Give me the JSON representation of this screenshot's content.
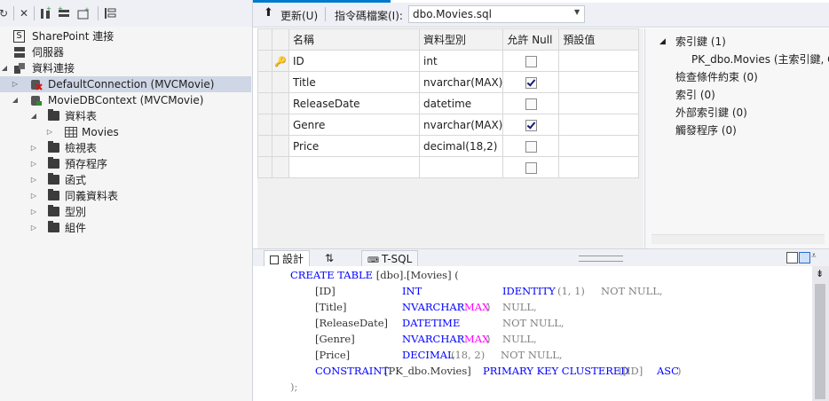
{
  "explorer": {
    "items": [
      {
        "label": "SharePoint 連接"
      },
      {
        "label": "伺服器"
      },
      {
        "label": "資料連接"
      },
      {
        "label": "DefaultConnection (MVCMovie)"
      },
      {
        "label": "MovieDBContext (MVCMovie)"
      },
      {
        "label": "資料表"
      },
      {
        "label": "Movies"
      },
      {
        "label": "檢視表"
      },
      {
        "label": "預存程序"
      },
      {
        "label": "函式"
      },
      {
        "label": "同義資料表"
      },
      {
        "label": "型別"
      },
      {
        "label": "組件"
      }
    ]
  },
  "designer_toolbar": {
    "update_label": "更新(U)",
    "script_file_label": "指令碼檔案(I):",
    "script_file_value": "dbo.Movies.sql"
  },
  "columns_grid": {
    "headers": [
      "名稱",
      "資料型別",
      "允許 Null",
      "預設值"
    ],
    "rows": [
      {
        "name": "ID",
        "type": "int",
        "allow_null": false,
        "key": true
      },
      {
        "name": "Title",
        "type": "nvarchar(MAX)",
        "allow_null": true,
        "key": false
      },
      {
        "name": "ReleaseDate",
        "type": "datetime",
        "allow_null": false,
        "key": false
      },
      {
        "name": "Genre",
        "type": "nvarchar(MAX)",
        "allow_null": true,
        "key": false
      },
      {
        "name": "Price",
        "type": "decimal(18,2)",
        "allow_null": false,
        "key": false
      },
      {
        "name": "",
        "type": "",
        "allow_null": false,
        "key": false
      }
    ]
  },
  "properties_panel": {
    "keys": "索引鍵 (1)",
    "pk": "PK_dbo.Movies (主索引鍵, C",
    "checks": "檢查條件約束 (0)",
    "indexes": "索引 (0)",
    "foreign_keys": "外部索引鍵 (0)",
    "triggers": "觸發程序 (0)"
  },
  "bottom_tabs": {
    "design": "設計",
    "swap": "⇅",
    "tsql": "T-SQL"
  },
  "sql": {
    "l1_kw": "CREATE TABLE",
    "l1_rest": " [dbo].[Movies] (",
    "c1_name": "[ID]",
    "c1_type": "INT",
    "c1_kw": "IDENTITY",
    "c1_args": "(1, 1)",
    "c1_null": "NOT NULL,",
    "c2_name": "[Title]",
    "c2_type": "NVARCHAR",
    "c2_open": "(",
    "c2_max": "MAX",
    "c2_close": ")",
    "c2_null": "NULL,",
    "c3_name": "[ReleaseDate]",
    "c3_type": "DATETIME",
    "c3_null": "NOT NULL,",
    "c4_name": "[Genre]",
    "c4_type": "NVARCHAR",
    "c4_open": "(",
    "c4_max": "MAX",
    "c4_close": ")",
    "c4_null": "NULL,",
    "c5_name": "[Price]",
    "c5_type": "DECIMAL",
    "c5_args": "(18, 2)",
    "c5_null": "NOT NULL,",
    "cons_kw": "CONSTRAINT",
    "cons_name": "[PK_dbo.Movies]",
    "cons_kw2": "PRIMARY KEY CLUSTERED",
    "cons_args": "([ID]",
    "cons_asc": "ASC",
    "cons_close": ")",
    "end": ");"
  }
}
